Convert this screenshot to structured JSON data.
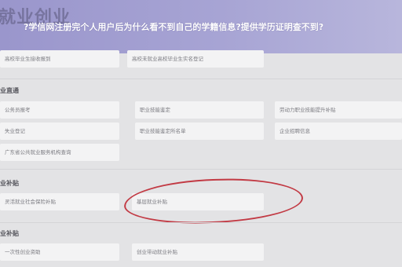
{
  "header": {
    "app_title": "就业创业",
    "banner": "?学信网注册完个人用户后为什么看不到自己的学籍信息?提供学历证明查不到?"
  },
  "top_row": [
    "高校毕业生接收报到",
    "高校未就业高校毕业生实名登记"
  ],
  "sections": [
    {
      "title": "业直通",
      "items": [
        "公务员报考",
        "职业技能鉴定",
        "劳动力职业技能提升补贴",
        "失业登记",
        "职业技能鉴定所名单",
        "企业招聘信息",
        "广东省公共就业服务机构查询"
      ]
    },
    {
      "title": "业补贴",
      "items": [
        "灵活就业社会保险补贴",
        "基层就业补贴"
      ]
    },
    {
      "title": "业补贴",
      "items": [
        "一次性创业资助",
        "创业带动就业补贴"
      ]
    }
  ],
  "highlight_color": "#c23a44"
}
